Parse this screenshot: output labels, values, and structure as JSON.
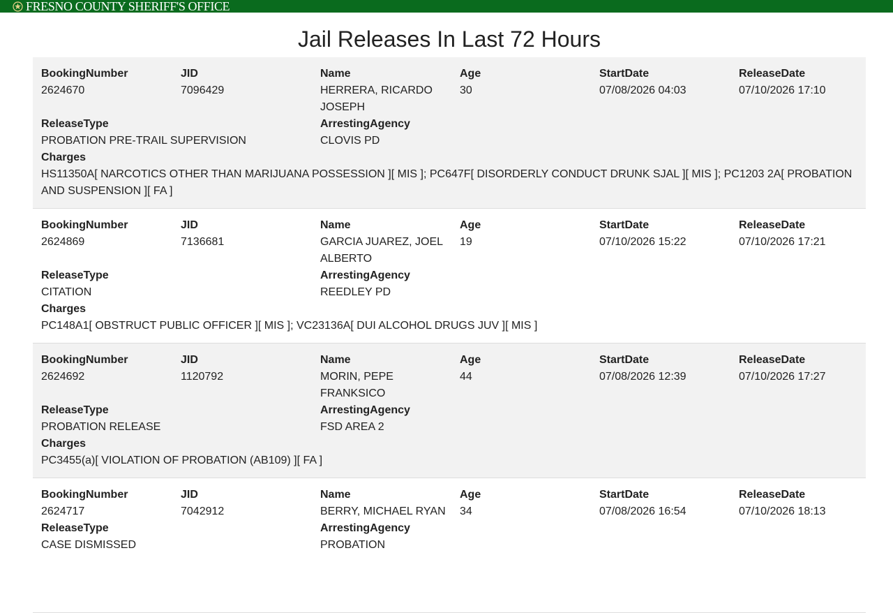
{
  "header": {
    "org_name": "FRESNO COUNTY SHERIFF'S OFFICE",
    "brand_color": "#0a6b1e",
    "badge_icon": "sheriff-star-icon"
  },
  "page": {
    "title": "Jail Releases In Last 72 Hours"
  },
  "labels": {
    "booking_number": "BookingNumber",
    "jid": "JID",
    "name": "Name",
    "age": "Age",
    "start_date": "StartDate",
    "release_date": "ReleaseDate",
    "release_type": "ReleaseType",
    "arresting_agency": "ArrestingAgency",
    "charges": "Charges"
  },
  "records": [
    {
      "booking_number": "2624670",
      "jid": "7096429",
      "name": "HERRERA, RICARDO JOSEPH",
      "age": "30",
      "start_date": "07/08/2026 04:03",
      "release_date": "07/10/2026 17:10",
      "release_type": "PROBATION PRE-TRAIL SUPERVISION",
      "arresting_agency": "CLOVIS PD",
      "charges": "HS11350A[ NARCOTICS OTHER THAN MARIJUANA POSSESSION ][ MIS ]; PC647F[ DISORDERLY CONDUCT DRUNK SJAL ][ MIS ]; PC1203 2A[ PROBATION AND SUSPENSION ][ FA ]"
    },
    {
      "booking_number": "2624869",
      "jid": "7136681",
      "name": "GARCIA JUAREZ, JOEL ALBERTO",
      "age": "19",
      "start_date": "07/10/2026 15:22",
      "release_date": "07/10/2026 17:21",
      "release_type": "CITATION",
      "arresting_agency": "REEDLEY PD",
      "charges": "PC148A1[ OBSTRUCT PUBLIC OFFICER ][ MIS ]; VC23136A[ DUI ALCOHOL DRUGS JUV ][ MIS ]"
    },
    {
      "booking_number": "2624692",
      "jid": "1120792",
      "name": "MORIN, PEPE FRANKSICO",
      "age": "44",
      "start_date": "07/08/2026 12:39",
      "release_date": "07/10/2026 17:27",
      "release_type": "PROBATION RELEASE",
      "arresting_agency": "FSD AREA 2",
      "charges": "PC3455(a)[ VIOLATION OF PROBATION (AB109) ][ FA ]"
    },
    {
      "booking_number": "2624717",
      "jid": "7042912",
      "name": "BERRY, MICHAEL RYAN",
      "age": "34",
      "start_date": "07/08/2026 16:54",
      "release_date": "07/10/2026 18:13",
      "release_type": "CASE DISMISSED",
      "arresting_agency": "PROBATION",
      "charges": ""
    }
  ]
}
